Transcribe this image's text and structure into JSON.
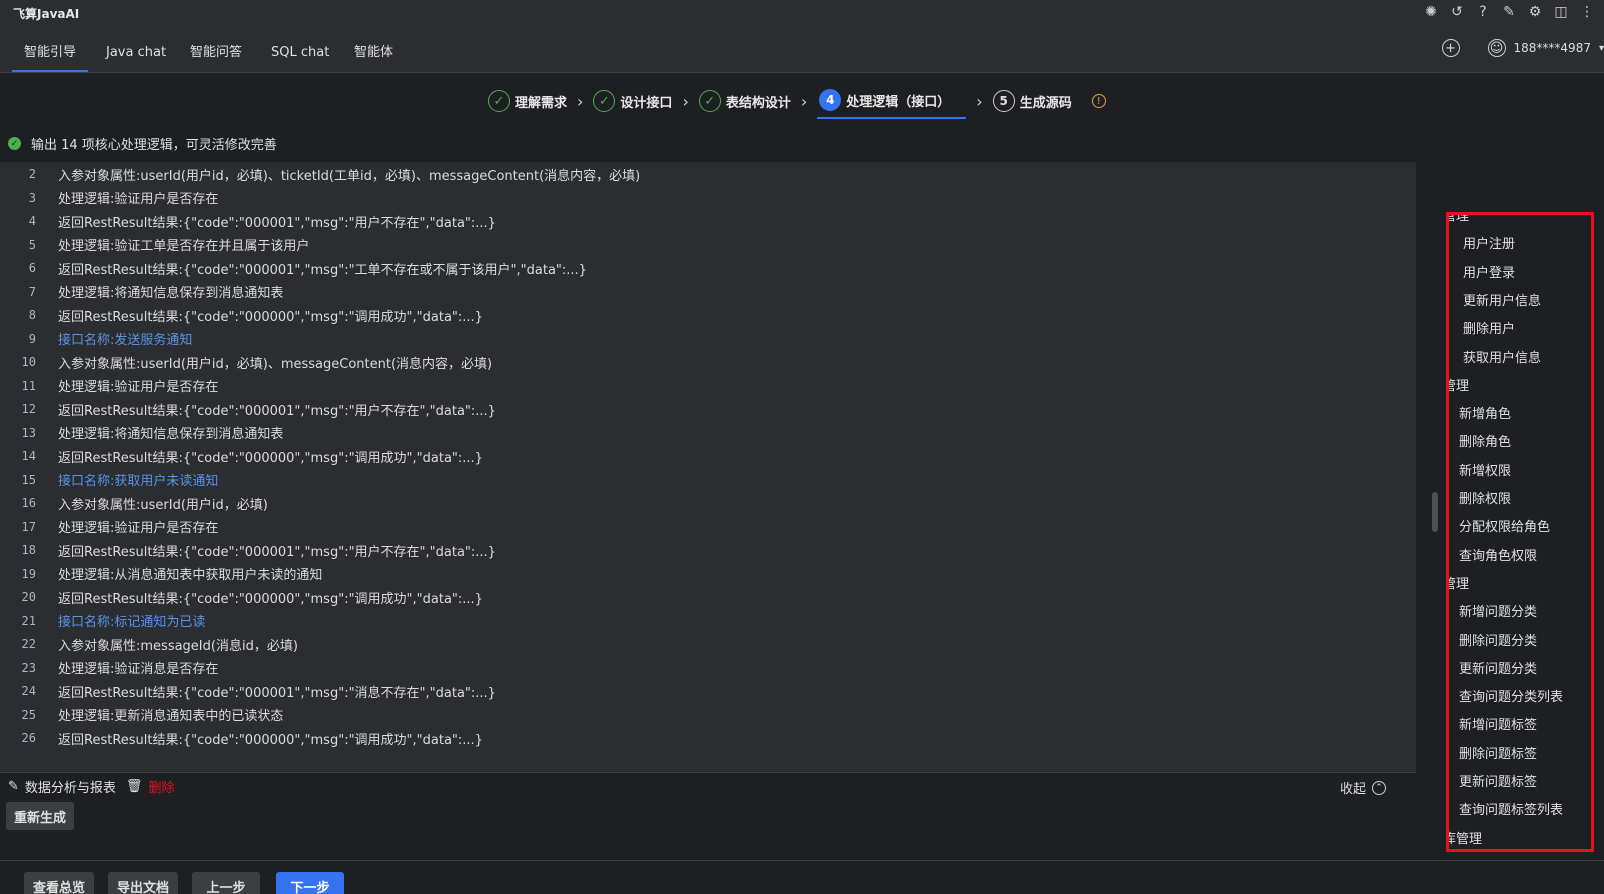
{
  "app": {
    "title": "飞算JavaAI"
  },
  "tabs": [
    {
      "label": "智能引导"
    },
    {
      "label": "Java chat"
    },
    {
      "label": "智能问答"
    },
    {
      "label": "SQL chat"
    },
    {
      "label": "智能体"
    }
  ],
  "user": {
    "phone": "188****4987"
  },
  "steps": [
    {
      "label": "理解需求",
      "state": "done"
    },
    {
      "label": "设计接口",
      "state": "done"
    },
    {
      "label": "表结构设计",
      "state": "done"
    },
    {
      "number": "4",
      "label": "处理逻辑（接口）",
      "state": "active"
    },
    {
      "number": "5",
      "label": "生成源码",
      "state": "pending"
    }
  ],
  "notice": "输出 14 项核心处理逻辑，可灵活修改完善",
  "code_lines": [
    {
      "n": "2",
      "text": "入参对象属性:userId(用户id，必填)、ticketId(工单id，必填)、messageContent(消息内容，必填)"
    },
    {
      "n": "3",
      "text": "处理逻辑:验证用户是否存在"
    },
    {
      "n": "4",
      "text": "返回RestResult结果:{\"code\":\"000001\",\"msg\":\"用户不存在\",\"data\":...}"
    },
    {
      "n": "5",
      "text": "处理逻辑:验证工单是否存在并且属于该用户"
    },
    {
      "n": "6",
      "text": "返回RestResult结果:{\"code\":\"000001\",\"msg\":\"工单不存在或不属于该用户\",\"data\":...}"
    },
    {
      "n": "7",
      "text": "处理逻辑:将通知信息保存到消息通知表"
    },
    {
      "n": "8",
      "text": "返回RestResult结果:{\"code\":\"000000\",\"msg\":\"调用成功\",\"data\":...}"
    },
    {
      "n": "9",
      "text": "接口名称:发送服务通知",
      "link": true
    },
    {
      "n": "10",
      "text": "入参对象属性:userId(用户id，必填)、messageContent(消息内容，必填)"
    },
    {
      "n": "11",
      "text": "处理逻辑:验证用户是否存在"
    },
    {
      "n": "12",
      "text": "返回RestResult结果:{\"code\":\"000001\",\"msg\":\"用户不存在\",\"data\":...}"
    },
    {
      "n": "13",
      "text": "处理逻辑:将通知信息保存到消息通知表"
    },
    {
      "n": "14",
      "text": "返回RestResult结果:{\"code\":\"000000\",\"msg\":\"调用成功\",\"data\":...}"
    },
    {
      "n": "15",
      "text": "接口名称:获取用户未读通知",
      "link": true
    },
    {
      "n": "16",
      "text": "入参对象属性:userId(用户id，必填)"
    },
    {
      "n": "17",
      "text": "处理逻辑:验证用户是否存在"
    },
    {
      "n": "18",
      "text": "返回RestResult结果:{\"code\":\"000001\",\"msg\":\"用户不存在\",\"data\":...}"
    },
    {
      "n": "19",
      "text": "处理逻辑:从消息通知表中获取用户未读的通知"
    },
    {
      "n": "20",
      "text": "返回RestResult结果:{\"code\":\"000000\",\"msg\":\"调用成功\",\"data\":...}"
    },
    {
      "n": "21",
      "text": "接口名称:标记通知为已读",
      "link": true
    },
    {
      "n": "22",
      "text": "入参对象属性:messageId(消息id，必填)"
    },
    {
      "n": "23",
      "text": "处理逻辑:验证消息是否存在"
    },
    {
      "n": "24",
      "text": "返回RestResult结果:{\"code\":\"000001\",\"msg\":\"消息不存在\",\"data\":...}"
    },
    {
      "n": "25",
      "text": "处理逻辑:更新消息通知表中的已读状态"
    },
    {
      "n": "26",
      "text": "返回RestResult结果:{\"code\":\"000000\",\"msg\":\"调用成功\",\"data\":...}"
    }
  ],
  "section": {
    "name": "数据分析与报表",
    "delete": "删除",
    "collapse": "收起"
  },
  "buttons": {
    "regenerate": "重新生成",
    "overview": "查看总览",
    "export": "导出文档",
    "prev": "上一步",
    "next": "下一步"
  },
  "outline": [
    {
      "label": "用户管理",
      "level": 0
    },
    {
      "label": "用户注册",
      "level": 1
    },
    {
      "label": "用户登录",
      "level": 1
    },
    {
      "label": "更新用户信息",
      "level": 1
    },
    {
      "label": "删除用户",
      "level": 1
    },
    {
      "label": "获取用户信息",
      "level": 1
    },
    {
      "label": "权限管理",
      "level": 0
    },
    {
      "label": "新增角色",
      "level": 1
    },
    {
      "label": "删除角色",
      "level": 1
    },
    {
      "label": "新增权限",
      "level": 1
    },
    {
      "label": "删除权限",
      "level": 1
    },
    {
      "label": "分配权限给角色",
      "level": 1
    },
    {
      "label": "查询角色权限",
      "level": 1
    },
    {
      "label": "问题管理",
      "level": 0
    },
    {
      "label": "新增问题分类",
      "level": 1
    },
    {
      "label": "删除问题分类",
      "level": 1
    },
    {
      "label": "更新问题分类",
      "level": 1
    },
    {
      "label": "查询问题分类列表",
      "level": 1
    },
    {
      "label": "新增问题标签",
      "level": 1
    },
    {
      "label": "删除问题标签",
      "level": 1
    },
    {
      "label": "更新问题标签",
      "level": 1
    },
    {
      "label": "查询问题标签列表",
      "level": 1
    },
    {
      "label": "知识库管理",
      "level": 0
    }
  ],
  "colors": {
    "accent": "#3574f0",
    "success": "#4caf50",
    "danger": "#e81123",
    "link": "#5895e8"
  }
}
